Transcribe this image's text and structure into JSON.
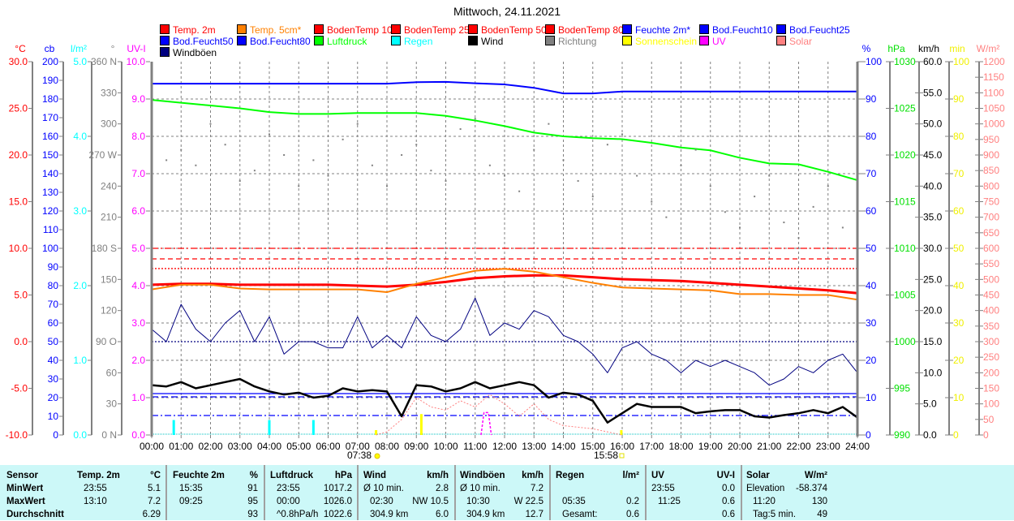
{
  "title": "Mittwoch, 24.11.2021",
  "legend": [
    {
      "label": "Temp. 2m",
      "color": "#ff0000"
    },
    {
      "label": "Temp. 5cm*",
      "color": "#ff8000"
    },
    {
      "label": "BodenTemp 10",
      "color": "#ff0000"
    },
    {
      "label": "BodenTemp 25",
      "color": "#ff0000"
    },
    {
      "label": "BodenTemp 50",
      "color": "#ff0000"
    },
    {
      "label": "BodenTemp 80",
      "color": "#ff0000"
    },
    {
      "label": "Feuchte 2m*",
      "color": "#0000ff"
    },
    {
      "label": "Bod.Feucht10",
      "color": "#0000ff"
    },
    {
      "label": "Bod.Feucht25",
      "color": "#0000ff"
    },
    {
      "label": "Bod.Feucht50",
      "color": "#0000ff"
    },
    {
      "label": "Bod.Feucht80",
      "color": "#0000ff"
    },
    {
      "label": "Luftdruck",
      "color": "#00ff00"
    },
    {
      "label": "Regen",
      "color": "#00ffff"
    },
    {
      "label": "Wind",
      "color": "#000000"
    },
    {
      "label": "Richtung",
      "color": "#808080"
    },
    {
      "label": "Sonnenschein",
      "color": "#ffff00"
    },
    {
      "label": "UV",
      "color": "#ff00ff"
    },
    {
      "label": "Solar",
      "color": "#ff8080"
    },
    {
      "label": "Windböen",
      "color": "#000080"
    }
  ],
  "chart_data": {
    "type": "line",
    "title": "Mittwoch, 24.11.2021",
    "x_ticks": [
      "00:00",
      "01:00",
      "02:00",
      "03:00",
      "04:00",
      "05:00",
      "06:00",
      "07:00",
      "08:00",
      "09:00",
      "10:00",
      "11:00",
      "12:00",
      "13:00",
      "14:00",
      "15:00",
      "16:00",
      "17:00",
      "18:00",
      "19:00",
      "20:00",
      "21:00",
      "22:00",
      "23:00",
      "24:00"
    ],
    "xlim_hours": [
      0,
      24
    ],
    "sunrise": "07:38",
    "sunset": "15:58",
    "axes": {
      "temp": {
        "unit": "°C",
        "range": [
          -10,
          30
        ],
        "step": 5,
        "color": "#ff0000",
        "labels": [
          "-10.0",
          "-5.0",
          "0.0",
          "5.0",
          "10.0",
          "15.0",
          "20.0",
          "25.0",
          "30.0"
        ]
      },
      "cb": {
        "unit": "cb",
        "range": [
          0,
          200
        ],
        "step": 10,
        "color": "#0000ff",
        "labels": [
          "0",
          "10",
          "20",
          "30",
          "40",
          "50",
          "60",
          "70",
          "80",
          "90",
          "100",
          "110",
          "120",
          "130",
          "140",
          "150",
          "160",
          "170",
          "180",
          "190",
          "200"
        ]
      },
      "rain": {
        "unit": "l/m²",
        "range": [
          0,
          5
        ],
        "step": 1,
        "color": "#00ffff",
        "labels": [
          "0.0",
          "1.0",
          "2.0",
          "3.0",
          "4.0",
          "5.0"
        ]
      },
      "dir": {
        "unit": "°",
        "range": [
          0,
          360
        ],
        "step": 30,
        "color": "#808080",
        "labels": [
          "0 N",
          "30",
          "60",
          "90 O",
          "120",
          "150",
          "180 S",
          "210",
          "240",
          "270 W",
          "300",
          "330",
          "360 N"
        ]
      },
      "uv": {
        "unit": "UV-I",
        "range": [
          0,
          10
        ],
        "step": 1,
        "color": "#ff00ff",
        "labels": [
          "0.0",
          "1.0",
          "2.0",
          "3.0",
          "4.0",
          "5.0",
          "6.0",
          "7.0",
          "8.0",
          "9.0",
          "10.0"
        ]
      },
      "hum": {
        "unit": "%",
        "range": [
          0,
          100
        ],
        "step": 10,
        "color": "#0000ff",
        "labels": [
          "0",
          "10",
          "20",
          "30",
          "40",
          "50",
          "60",
          "70",
          "80",
          "90",
          "100"
        ]
      },
      "press": {
        "unit": "hPa",
        "range": [
          990,
          1030
        ],
        "step": 5,
        "color": "#00ff00",
        "labels": [
          "990",
          "995",
          "1000",
          "1005",
          "1010",
          "1015",
          "1020",
          "1025",
          "1030"
        ]
      },
      "wind": {
        "unit": "km/h",
        "range": [
          0,
          60
        ],
        "step": 5,
        "color": "#000000",
        "labels": [
          "0.0",
          "5.0",
          "10.0",
          "15.0",
          "20.0",
          "25.0",
          "30.0",
          "35.0",
          "40.0",
          "45.0",
          "50.0",
          "55.0",
          "60.0"
        ]
      },
      "sun": {
        "unit": "min",
        "range": [
          0,
          100
        ],
        "step": 10,
        "color": "#ffff00",
        "labels": [
          "0",
          "10",
          "20",
          "30",
          "40",
          "50",
          "60",
          "70",
          "80",
          "90",
          "100"
        ]
      },
      "solar": {
        "unit": "W/m²",
        "range": [
          0,
          1200
        ],
        "step": 50,
        "color": "#ff8080",
        "labels": [
          "0",
          "50",
          "100",
          "150",
          "200",
          "250",
          "300",
          "350",
          "400",
          "450",
          "500",
          "550",
          "600",
          "650",
          "700",
          "750",
          "800",
          "850",
          "900",
          "950",
          "1000",
          "1050",
          "1100",
          "1150",
          "1200"
        ]
      }
    },
    "series": [
      {
        "name": "Temp. 2m",
        "axis": "temp",
        "color": "#ff0000",
        "width": 3,
        "interval_h": 1,
        "values": [
          6.1,
          6.2,
          6.2,
          6.1,
          6.1,
          6.1,
          6.1,
          6.0,
          5.9,
          6.1,
          6.4,
          6.8,
          7.0,
          7.1,
          7.1,
          6.9,
          6.7,
          6.6,
          6.5,
          6.3,
          6.1,
          5.9,
          5.7,
          5.5,
          5.2
        ]
      },
      {
        "name": "Temp. 5cm*",
        "axis": "temp",
        "color": "#ff8000",
        "width": 2,
        "interval_h": 1,
        "values": [
          5.6,
          6.1,
          6.1,
          5.7,
          5.6,
          5.6,
          5.6,
          5.6,
          5.3,
          6.2,
          6.9,
          7.6,
          7.8,
          7.5,
          6.9,
          6.3,
          5.8,
          5.7,
          5.6,
          5.5,
          5.1,
          5.1,
          5.0,
          5.0,
          4.5
        ]
      },
      {
        "name": "Feuchte 2m*",
        "axis": "hum",
        "color": "#0000ff",
        "width": 2,
        "interval_h": 1,
        "values": [
          94.1,
          94.1,
          94.1,
          94.1,
          94.1,
          94.1,
          94.1,
          94.1,
          94.1,
          94.5,
          94.6,
          94.2,
          93.9,
          93.0,
          91.5,
          91.5,
          92.0,
          92.0,
          92.0,
          92.0,
          92.0,
          92.0,
          92.0,
          92.0,
          92.0
        ]
      },
      {
        "name": "Luftdruck",
        "axis": "press",
        "color": "#00ff00",
        "width": 2,
        "interval_h": 1,
        "values": [
          1025.9,
          1025.6,
          1025.3,
          1025.0,
          1024.6,
          1024.4,
          1024.4,
          1024.5,
          1024.5,
          1024.5,
          1024.2,
          1023.7,
          1023.1,
          1022.4,
          1022.0,
          1021.8,
          1021.7,
          1021.3,
          1020.8,
          1020.5,
          1019.7,
          1019.1,
          1019.0,
          1018.2,
          1017.3
        ]
      },
      {
        "name": "Windböen",
        "axis": "wind",
        "color": "#000080",
        "width": 1,
        "interval_h": 0.5,
        "values": [
          17,
          15,
          21,
          17,
          15,
          18,
          20,
          15,
          19,
          13,
          15,
          15,
          14,
          14,
          19,
          14,
          16,
          14,
          19,
          16,
          15,
          17,
          22,
          16,
          18,
          17,
          20,
          19,
          16,
          15,
          13,
          10,
          14,
          15,
          13,
          12,
          10,
          12,
          11,
          12,
          11,
          10,
          8,
          9,
          11,
          10,
          12,
          13,
          10
        ]
      },
      {
        "name": "Wind",
        "axis": "wind",
        "color": "#000000",
        "width": 2.5,
        "interval_h": 0.5,
        "values": [
          8.0,
          7.8,
          8.5,
          7.5,
          8.0,
          8.5,
          9.0,
          7.8,
          7.0,
          6.5,
          6.8,
          6.0,
          6.3,
          7.5,
          7.0,
          7.2,
          7.0,
          3.0,
          8.0,
          7.8,
          7.0,
          7.5,
          8.5,
          7.5,
          8.0,
          8.5,
          8.0,
          6.0,
          6.8,
          6.5,
          5.5,
          2.0,
          3.5,
          5.0,
          4.5,
          4.5,
          4.5,
          3.5,
          3.8,
          4.0,
          4.0,
          3.0,
          2.8,
          3.2,
          3.5,
          4.0,
          3.5,
          4.5,
          2.8
        ]
      },
      {
        "name": "Richtung",
        "axis": "dir",
        "color": "#808080",
        "type": "scatter",
        "interval_h": 0.5,
        "values": [
          250,
          265,
          275,
          260,
          300,
          280,
          245,
          255,
          290,
          270,
          240,
          265,
          250,
          285,
          300,
          260,
          240,
          270,
          280,
          255,
          245,
          295,
          305,
          260,
          250,
          235,
          275,
          300,
          265,
          245,
          230,
          280,
          290,
          250,
          225,
          210,
          260,
          275,
          240,
          215,
          200,
          230,
          250,
          205,
          190,
          220,
          240,
          200,
          210
        ]
      },
      {
        "name": "Solar",
        "axis": "solar",
        "color": "#ff8080",
        "width": 1,
        "dash": "2,2",
        "points": [
          [
            7.63,
            0
          ],
          [
            8.0,
            10
          ],
          [
            8.5,
            50
          ],
          [
            9.0,
            120
          ],
          [
            9.5,
            90
          ],
          [
            10.0,
            80
          ],
          [
            10.5,
            110
          ],
          [
            11.0,
            90
          ],
          [
            11.5,
            130
          ],
          [
            12.0,
            100
          ],
          [
            12.5,
            60
          ],
          [
            13.0,
            100
          ],
          [
            13.5,
            50
          ],
          [
            14.0,
            30
          ],
          [
            14.5,
            25
          ],
          [
            15.0,
            20
          ],
          [
            15.5,
            10
          ],
          [
            15.97,
            0
          ]
        ]
      },
      {
        "name": "UV",
        "axis": "uv",
        "color": "#ff00ff",
        "width": 1.5,
        "dash": "3,2",
        "points": [
          [
            11.2,
            0
          ],
          [
            11.3,
            0.6
          ],
          [
            11.45,
            0.6
          ],
          [
            11.55,
            0
          ]
        ]
      }
    ],
    "bars": [
      {
        "name": "Regen",
        "axis": "rain",
        "color": "#00ffff",
        "points": [
          [
            0.75,
            0.2
          ],
          [
            4.0,
            0.2
          ],
          [
            5.5,
            0.2
          ]
        ]
      },
      {
        "name": "Sonnenschein",
        "axis": "sun",
        "color": "#ffff00",
        "points": [
          [
            7.63,
            1.3
          ],
          [
            9.17,
            5.6
          ],
          [
            15.97,
            1.3
          ]
        ]
      }
    ],
    "reference_lines": [
      {
        "axis": "temp",
        "value": 10.0,
        "color": "#ff0000",
        "dash": "8,3,2,3"
      },
      {
        "axis": "temp",
        "value": 8.87,
        "color": "#ff0000",
        "dash": "6,4"
      },
      {
        "axis": "temp",
        "value": 7.83,
        "color": "#ff0000",
        "dash": "2,2"
      },
      {
        "axis": "wind",
        "value": 15.0,
        "color": "#000080",
        "dash": "2,2"
      },
      {
        "axis": "wind",
        "value": 6.65,
        "color": "#0000ff",
        "dash": ""
      },
      {
        "axis": "wind",
        "value": 6.13,
        "color": "#0000ff",
        "dash": "8,4"
      },
      {
        "axis": "wind",
        "value": 3.13,
        "color": "#0000ff",
        "dash": "8,3,2,3"
      }
    ]
  },
  "table": {
    "sensor": [
      "Sensor",
      "MinWert",
      "MaxWert",
      "Durchschnitt"
    ],
    "groups": [
      {
        "header": [
          "Temp. 2m",
          "°C"
        ],
        "rows": [
          [
            "23:55",
            "5.1"
          ],
          [
            "13:10",
            "7.2"
          ],
          [
            "",
            "6.29"
          ]
        ]
      },
      {
        "header": [
          "Feuchte 2m",
          "%"
        ],
        "rows": [
          [
            "15:35",
            "91"
          ],
          [
            "09:25",
            "95"
          ],
          [
            "",
            "93"
          ]
        ]
      },
      {
        "header": [
          "Luftdruck",
          "hPa"
        ],
        "rows": [
          [
            "23:55",
            "1017.2"
          ],
          [
            "00:00",
            "1026.0"
          ],
          [
            "^0.8hPa/h",
            "1022.6"
          ]
        ]
      },
      {
        "header": [
          "Wind",
          "km/h"
        ],
        "rows": [
          [
            "Ø 10 min.",
            "2.8"
          ],
          [
            "02:30",
            "NW 10.5"
          ],
          [
            "304.9 km",
            "6.0"
          ]
        ]
      },
      {
        "header": [
          "Windböen",
          "km/h"
        ],
        "rows": [
          [
            "Ø 10 min.",
            "7.2"
          ],
          [
            "10:30",
            "W 22.5"
          ],
          [
            "304.9 km",
            "12.7"
          ]
        ]
      },
      {
        "header": [
          "Regen",
          "l/m²"
        ],
        "rows": [
          [
            "",
            ""
          ],
          [
            "05:35",
            "0.2"
          ],
          [
            "Gesamt:",
            "0.6"
          ]
        ]
      },
      {
        "header": [
          "UV",
          "UV-I"
        ],
        "rows": [
          [
            "23:55",
            "0.0"
          ],
          [
            "11:25",
            "0.6"
          ],
          [
            "",
            "0.6"
          ]
        ]
      },
      {
        "header": [
          "Solar",
          "W/m²"
        ],
        "rows": [
          [
            "Elevation",
            "-58.374"
          ],
          [
            "11:20",
            "130"
          ],
          [
            "Tag:5 min.",
            "49"
          ]
        ]
      }
    ]
  }
}
